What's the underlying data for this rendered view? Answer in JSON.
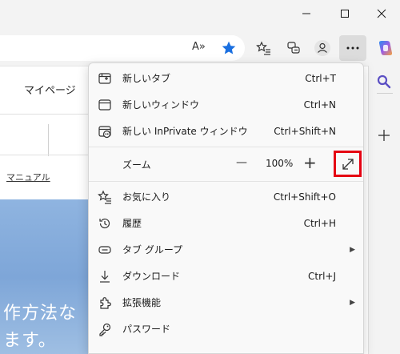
{
  "window": {
    "minimize_icon": "minimize-icon",
    "maximize_icon": "maximize-icon",
    "close_icon": "close-icon"
  },
  "toolbar": {
    "read_aloud": "A»",
    "icons": [
      "read-aloud-icon",
      "favorite-star-icon",
      "favorites-list-icon",
      "collections-icon",
      "profile-icon",
      "more-icon",
      "copilot-icon"
    ]
  },
  "page": {
    "mypage": "マイページ",
    "manual": "マニュアル",
    "hero_line1": "作方法な",
    "hero_line2": "ます。"
  },
  "menu": {
    "items_top": [
      {
        "label": "新しいタブ",
        "shortcut": "Ctrl+T",
        "icon": "new-tab-icon"
      },
      {
        "label": "新しいウィンドウ",
        "shortcut": "Ctrl+N",
        "icon": "new-window-icon"
      },
      {
        "label": "新しい InPrivate ウィンドウ",
        "shortcut": "Ctrl+Shift+N",
        "icon": "inprivate-window-icon"
      }
    ],
    "zoom": {
      "label": "ズーム",
      "minus": "—",
      "value": "100%",
      "plus": "+",
      "fullscreen_icon": "fullscreen-icon"
    },
    "items_bottom": [
      {
        "label": "お気に入り",
        "shortcut": "Ctrl+Shift+O",
        "icon": "favorites-icon",
        "submenu": false
      },
      {
        "label": "履歴",
        "shortcut": "Ctrl+H",
        "icon": "history-icon",
        "submenu": false
      },
      {
        "label": "タブ グループ",
        "shortcut": "",
        "icon": "tab-groups-icon",
        "submenu": true
      },
      {
        "label": "ダウンロード",
        "shortcut": "Ctrl+J",
        "icon": "download-icon",
        "submenu": false
      },
      {
        "label": "拡張機能",
        "shortcut": "",
        "icon": "extensions-icon",
        "submenu": true
      },
      {
        "label": "パスワード",
        "shortcut": "",
        "icon": "password-key-icon",
        "submenu": false
      }
    ]
  },
  "sidebar": {
    "icons": [
      "search-icon",
      "add-icon"
    ]
  },
  "colors": {
    "highlight": "#e50012",
    "accent_blue": "#1a73e8",
    "sky": "#6f9fd4"
  }
}
